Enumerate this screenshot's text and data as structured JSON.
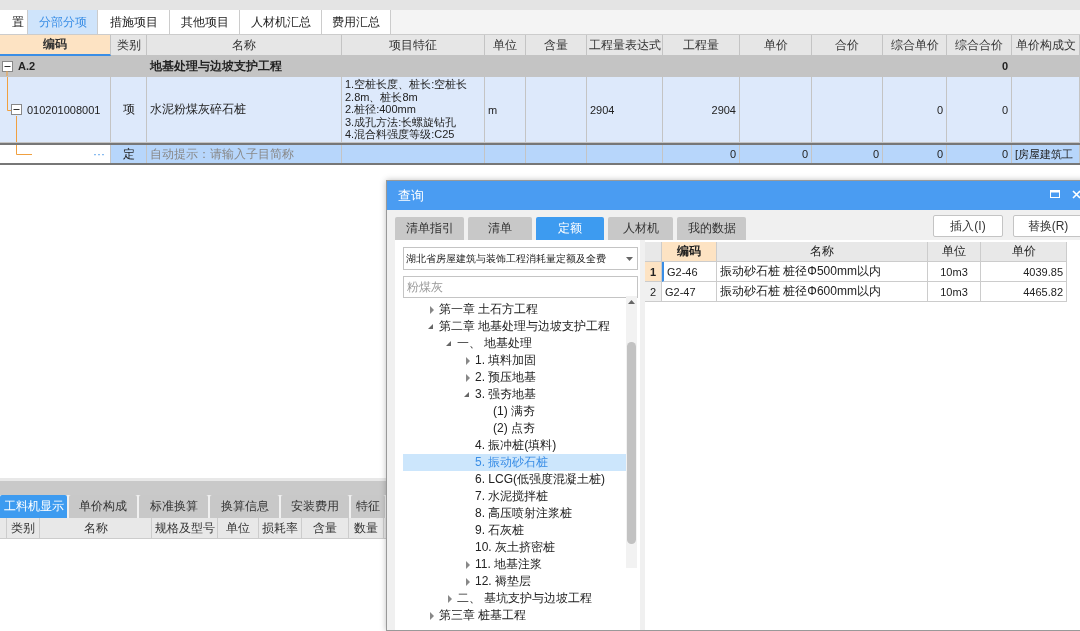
{
  "top_tabs": [
    {
      "label": "置",
      "selected": false
    },
    {
      "label": "分部分项",
      "selected": true
    },
    {
      "label": "措施项目",
      "selected": false
    },
    {
      "label": "其他项目",
      "selected": false
    },
    {
      "label": "人材机汇总",
      "selected": false
    },
    {
      "label": "费用汇总",
      "selected": false
    }
  ],
  "grid": {
    "columns": [
      {
        "label": "编码",
        "selected": true
      },
      {
        "label": "类别",
        "selected": false
      },
      {
        "label": "名称",
        "selected": false
      },
      {
        "label": "项目特征",
        "selected": false
      },
      {
        "label": "单位",
        "selected": false
      },
      {
        "label": "含量",
        "selected": false
      },
      {
        "label": "工程量表达式",
        "selected": false
      },
      {
        "label": "工程量",
        "selected": false
      },
      {
        "label": "单价",
        "selected": false
      },
      {
        "label": "合价",
        "selected": false
      },
      {
        "label": "综合单价",
        "selected": false
      },
      {
        "label": "综合合价",
        "selected": false
      },
      {
        "label": "单价构成文",
        "selected": false
      }
    ],
    "rows": [
      {
        "kind": "section",
        "expanded": true,
        "selected": false,
        "cells": [
          "A.2",
          null,
          "地基处理与边坡支护工程",
          null,
          null,
          null,
          null,
          null,
          null,
          null,
          null,
          "0",
          null
        ]
      },
      {
        "kind": "item",
        "expanded": true,
        "selected": false,
        "cells": [
          "010201008001",
          "项",
          "水泥粉煤灰碎石桩",
          "1.空桩长度、桩长:空桩长\n2.8m、桩长8m\n2.桩径:400mm\n3.成孔方法:长螺旋钻孔\n4.混合料强度等级:C25",
          "m",
          null,
          "2904",
          "2904",
          null,
          null,
          "0",
          "0",
          null
        ]
      },
      {
        "kind": "entry",
        "selected": true,
        "button": "···",
        "placeholder": "自动提示：请输入子目简称",
        "cells": [
          null,
          "定",
          null,
          null,
          null,
          null,
          null,
          "0",
          "0",
          "0",
          "0",
          "0",
          "[房屋建筑工"
        ]
      }
    ]
  },
  "lower": {
    "tabs": [
      {
        "label": "工料机显示",
        "selected": true
      },
      {
        "label": "单价构成",
        "selected": false
      },
      {
        "label": "标准换算",
        "selected": false
      },
      {
        "label": "换算信息",
        "selected": false
      },
      {
        "label": "安装费用",
        "selected": false
      },
      {
        "label": "特征",
        "selected": false
      }
    ],
    "columns": [
      "类别",
      "名称",
      "规格及型号",
      "单位",
      "损耗率",
      "含量",
      "数量"
    ]
  },
  "dialog": {
    "title": "查询",
    "tabs": [
      {
        "label": "清单指引",
        "selected": false
      },
      {
        "label": "清单",
        "selected": false
      },
      {
        "label": "定额",
        "selected": true
      },
      {
        "label": "人材机",
        "selected": false
      },
      {
        "label": "我的数据",
        "selected": false
      }
    ],
    "buttons": [
      "插入(I)",
      "替换(R)"
    ],
    "library": "湖北省房屋建筑与装饰工程消耗量定额及全费",
    "search_placeholder": "粉煤灰",
    "tree": [
      {
        "label": "第一章 土石方工程",
        "expanded": false,
        "selected": false
      },
      {
        "label": "第二章 地基处理与边坡支护工程",
        "expanded": true,
        "selected": false,
        "children": [
          {
            "label": "一、 地基处理",
            "expanded": true,
            "selected": false,
            "children": [
              {
                "label": "1. 填料加固",
                "expanded": false,
                "selected": false
              },
              {
                "label": "2. 预压地基",
                "expanded": false,
                "selected": false
              },
              {
                "label": "3. 强夯地基",
                "expanded": true,
                "selected": false,
                "children": [
                  {
                    "label": "(1) 满夯",
                    "selected": false
                  },
                  {
                    "label": "(2) 点夯",
                    "selected": false
                  }
                ]
              },
              {
                "label": "4. 振冲桩(填料)",
                "selected": false
              },
              {
                "label": "5. 振动砂石桩",
                "selected": true
              },
              {
                "label": "6. LCG(低强度混凝土桩)",
                "selected": false
              },
              {
                "label": "7. 水泥搅拌桩",
                "selected": false
              },
              {
                "label": "8. 高压喷射注浆桩",
                "selected": false
              },
              {
                "label": "9. 石灰桩",
                "selected": false
              },
              {
                "label": "10. 灰土挤密桩",
                "selected": false
              },
              {
                "label": "11. 地基注浆",
                "expanded": false,
                "selected": false
              },
              {
                "label": "12. 褥垫层",
                "expanded": false,
                "selected": false
              }
            ]
          },
          {
            "label": "二、 基坑支护与边坡工程",
            "expanded": false,
            "selected": false
          }
        ]
      },
      {
        "label": "第三章 桩基工程",
        "expanded": false,
        "selected": false
      }
    ],
    "results": {
      "columns": [
        {
          "label": "编码",
          "selected": true
        },
        {
          "label": "名称",
          "selected": false
        },
        {
          "label": "单位",
          "selected": false
        },
        {
          "label": "单价",
          "selected": false
        }
      ],
      "rows": [
        {
          "number": "1",
          "code": "G2-46",
          "name": "振动砂石桩 桩径Φ500mm以内",
          "unit": "10m3",
          "price": "4039.85",
          "selected": true
        },
        {
          "number": "2",
          "code": "G2-47",
          "name": "振动砂石桩 桩径Φ600mm以内",
          "unit": "10m3",
          "price": "4465.82",
          "selected": false
        }
      ]
    }
  }
}
